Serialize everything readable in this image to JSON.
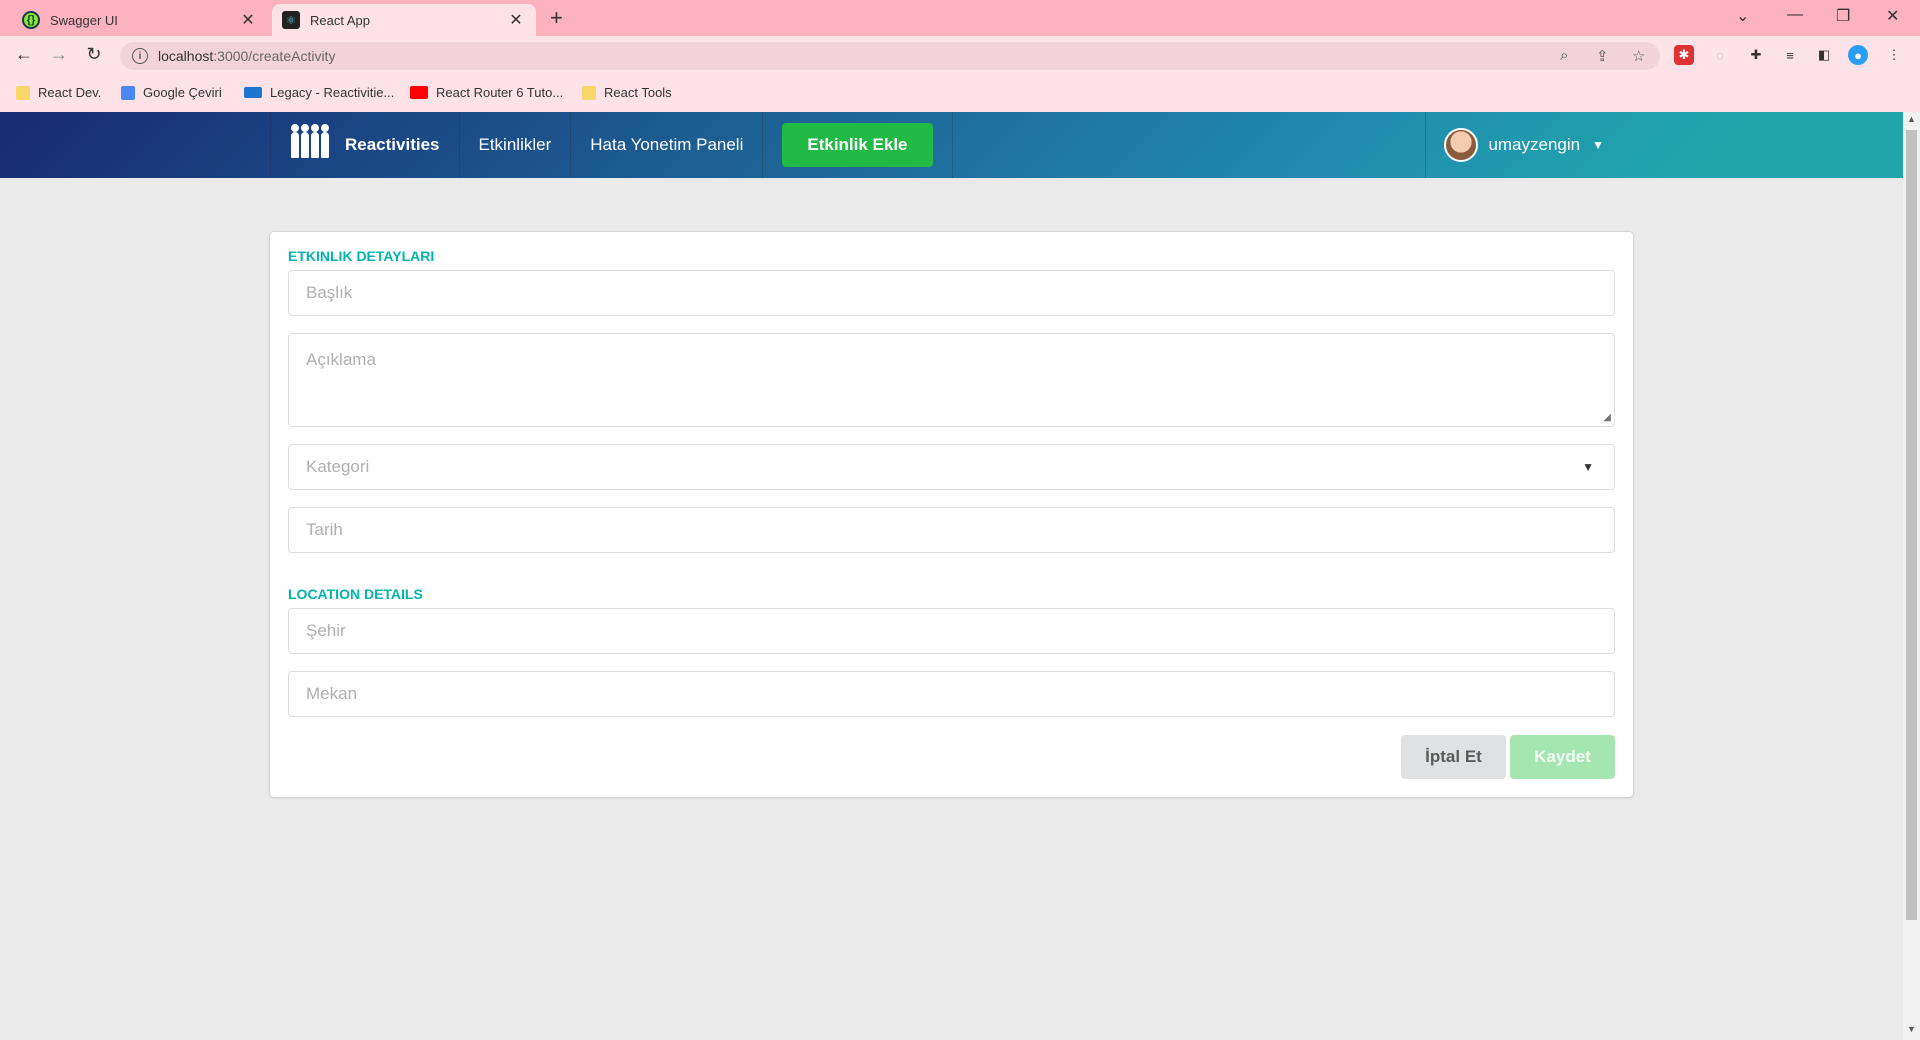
{
  "browser": {
    "tabs": [
      {
        "title": "Swagger UI",
        "active": false
      },
      {
        "title": "React App",
        "active": true
      }
    ],
    "url_host": "localhost",
    "url_rest": ":3000/createActivity",
    "bookmarks": [
      {
        "label": "React Dev.",
        "icon": "folder-icon"
      },
      {
        "label": "Google Çeviri",
        "icon": "google-translate-icon"
      },
      {
        "label": "Legacy - Reactivitie...",
        "icon": "onedrive-icon"
      },
      {
        "label": "React Router 6 Tuto...",
        "icon": "youtube-icon"
      },
      {
        "label": "React Tools",
        "icon": "folder-icon"
      }
    ]
  },
  "nav": {
    "brand": "Reactivities",
    "items": [
      "Etkinlikler",
      "Hata Yonetim Paneli"
    ],
    "add_button": "Etkinlik Ekle",
    "username": "umayzengin"
  },
  "form": {
    "section1_title": "ETKINLIK DETAYLARI",
    "title_placeholder": "Başlık",
    "description_placeholder": "Açıklama",
    "category_placeholder": "Kategori",
    "date_placeholder": "Tarih",
    "section2_title": "LOCATION DETAILS",
    "city_placeholder": "Şehir",
    "venue_placeholder": "Mekan",
    "cancel_label": "İptal Et",
    "save_label": "Kaydet"
  },
  "colors": {
    "nav_gradient_start": "#182a73",
    "nav_gradient_end": "#20a7ac",
    "accent_teal": "#00b5ad",
    "add_button_green": "#21ba45",
    "save_button_disabled": "#a5e6b0"
  }
}
